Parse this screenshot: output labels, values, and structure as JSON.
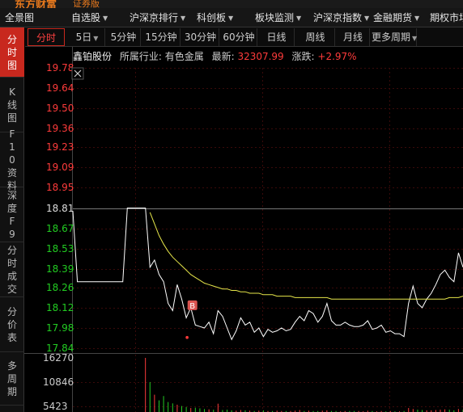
{
  "brand": {
    "logo": "东方财富",
    "sub": "证券版"
  },
  "menu": [
    {
      "label": "全景图",
      "caret": false
    },
    {
      "label": "自选股",
      "caret": true
    },
    {
      "label": "沪深京排行",
      "caret": true
    },
    {
      "label": "科创板",
      "caret": true
    },
    {
      "label": "板块监测",
      "caret": true
    },
    {
      "label": "沪深京指数",
      "caret": true
    },
    {
      "label": "金融期货",
      "caret": true
    },
    {
      "label": "期权市场",
      "caret": false
    }
  ],
  "sidebar": [
    {
      "label": "分时图",
      "active": true
    },
    {
      "label": "K线图",
      "active": false
    },
    {
      "label": "F10资料",
      "active": false
    },
    {
      "label": "深度F9",
      "active": false
    },
    {
      "label": "分时成交",
      "active": false
    },
    {
      "label": "分价表",
      "active": false
    },
    {
      "label": "多周期",
      "active": false
    }
  ],
  "toolbar": [
    {
      "label": "分时",
      "active": true,
      "caret": false
    },
    {
      "label": "5日",
      "active": false,
      "caret": true
    },
    {
      "label": "5分钟",
      "active": false,
      "caret": false
    },
    {
      "label": "15分钟",
      "active": false,
      "caret": false
    },
    {
      "label": "30分钟",
      "active": false,
      "caret": false
    },
    {
      "label": "60分钟",
      "active": false,
      "caret": false
    },
    {
      "label": "日线",
      "active": false,
      "caret": false
    },
    {
      "label": "周线",
      "active": false,
      "caret": false
    },
    {
      "label": "月线",
      "active": false,
      "caret": false
    },
    {
      "label": "更多周期",
      "active": false,
      "caret": true
    }
  ],
  "info": {
    "stock_name": "鑫铂股份",
    "industry_label": "所属行业:",
    "industry": "有色金属",
    "latest_label": "最新:",
    "latest": "32307.99",
    "change_label": "涨跌:",
    "change": "+2.97%"
  },
  "colors": {
    "up": "#ff3b3b",
    "down": "#22cc22",
    "price_line": "#ffffff",
    "avg_line": "#e6e64a",
    "grid": "#3a0000",
    "accent": "#c8281e"
  },
  "icons": {
    "close": "close-icon",
    "buy_marker": "buy-marker-icon"
  },
  "chart_data": {
    "type": "line",
    "price_ticks": [
      "19.78",
      "19.64",
      "19.50",
      "19.36",
      "19.23",
      "19.09",
      "18.95",
      "18.81",
      "18.67",
      "18.53",
      "18.39",
      "18.26",
      "18.12",
      "17.98",
      "17.84"
    ],
    "prev_close": 18.81,
    "ylim": [
      17.84,
      19.78
    ],
    "volume_ticks": [
      "16270",
      "10846",
      "5423"
    ],
    "buy_marker_label": "B",
    "series": [
      {
        "values": [
          18.79,
          18.3,
          18.3,
          18.3,
          18.3,
          18.3,
          18.3,
          18.3,
          18.3,
          18.3,
          18.3,
          18.3,
          18.81,
          18.81,
          18.81,
          18.81,
          18.81,
          18.4,
          18.45,
          18.35,
          18.3,
          18.15,
          18.1,
          18.28,
          18.18,
          18.05,
          18.12,
          18.0,
          17.99,
          17.98,
          18.02,
          17.94,
          18.1,
          18.06,
          17.98,
          17.9,
          17.96,
          18.05,
          18.0,
          18.02,
          17.95,
          17.98,
          17.92,
          17.97,
          17.95,
          17.96,
          17.98,
          17.96,
          17.97,
          18.02,
          18.06,
          18.03,
          18.1,
          18.08,
          18.02,
          18.06,
          18.15,
          18.03,
          18.0,
          18.0,
          18.02,
          18.0,
          17.99,
          17.99,
          18.0,
          18.03,
          17.97,
          17.98,
          18.0,
          17.95,
          17.96,
          17.94,
          17.94,
          17.92,
          18.15,
          18.27,
          18.15,
          18.12,
          18.18,
          18.22,
          18.28,
          18.35,
          18.38,
          18.33,
          18.3,
          18.5,
          18.4
        ]
      },
      {
        "values": [
          null,
          null,
          null,
          null,
          null,
          null,
          null,
          null,
          null,
          null,
          null,
          null,
          null,
          null,
          null,
          null,
          null,
          18.78,
          18.7,
          18.62,
          18.56,
          18.51,
          18.47,
          18.44,
          18.41,
          18.38,
          18.35,
          18.33,
          18.31,
          18.29,
          18.28,
          18.27,
          18.26,
          18.25,
          18.25,
          18.24,
          18.24,
          18.23,
          18.23,
          18.22,
          18.22,
          18.22,
          18.21,
          18.21,
          18.21,
          18.2,
          18.2,
          18.2,
          18.2,
          18.19,
          18.19,
          18.19,
          18.19,
          18.19,
          18.19,
          18.19,
          18.19,
          18.18,
          18.18,
          18.18,
          18.18,
          18.18,
          18.18,
          18.18,
          18.18,
          18.18,
          18.18,
          18.18,
          18.18,
          18.18,
          18.18,
          18.18,
          18.18,
          18.18,
          18.18,
          18.18,
          18.18,
          18.18,
          18.18,
          18.18,
          18.18,
          18.18,
          18.18,
          18.19,
          18.19,
          18.19,
          18.2
        ]
      }
    ],
    "volume": [
      0,
      0,
      0,
      0,
      0,
      0,
      0,
      0,
      0,
      0,
      0,
      0,
      0,
      0,
      0,
      0,
      16270,
      9000,
      5200,
      3500,
      4800,
      3000,
      2600,
      2200,
      1800,
      1500,
      1200,
      1300,
      1100,
      900,
      800,
      700,
      2500,
      600,
      700,
      500,
      400,
      600,
      500,
      400,
      300,
      400,
      500,
      300,
      300,
      400,
      300,
      300,
      300,
      400,
      600,
      300,
      400,
      300,
      300,
      400,
      500,
      300,
      300,
      200,
      300,
      300,
      300,
      300,
      200,
      400,
      300,
      200,
      300,
      200,
      300,
      200,
      200,
      300,
      1200,
      900,
      700,
      600,
      500,
      500,
      600,
      700,
      800,
      700,
      500,
      900,
      700
    ]
  }
}
